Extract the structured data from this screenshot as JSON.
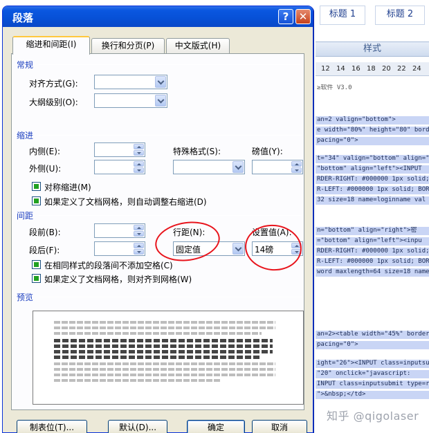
{
  "background": {
    "style_gallery": [
      "标题 1",
      "标题 2"
    ],
    "styles_caption": "样式",
    "ruler_ticks": [
      "12",
      "14",
      "16",
      "18",
      "20",
      "22",
      "24"
    ],
    "code_lines": [
      {
        "text": "≥软件 V3.0",
        "hl": false
      },
      {
        "text": "an=2 valign=\"bottom\">",
        "hl": true
      },
      {
        "text": "e width=\"80%\" height=\"80\" bord",
        "hl": true
      },
      {
        "text": "pacing=\"0\">",
        "hl": true
      },
      {
        "text": "t=\"34\" valign=\"bottom\" align=\"",
        "hl": true
      },
      {
        "text": "\"bottom\" align=\"left\"><INPUT",
        "hl": true
      },
      {
        "text": "RDER-RIGHT: #000000 1px solid;",
        "hl": true
      },
      {
        "text": "R-LEFT: #000000 1px solid; BOR",
        "hl": true
      },
      {
        "text": "32 size=18 name=loginname val",
        "hl": true
      },
      {
        "text": "n=\"bottom\" align=\"right\">密",
        "hl": true
      },
      {
        "text": "=\"bottom\" align=\"left\"><inpu",
        "hl": true
      },
      {
        "text": "RDER-RIGHT: #000000 1px solid;",
        "hl": true
      },
      {
        "text": "R-LEFT: #000000 1px solid; BOR",
        "hl": true
      },
      {
        "text": "word maxlength=64 size=18 name",
        "hl": true
      },
      {
        "text": "an=2><table width=\"45%\" border",
        "hl": true
      },
      {
        "text": "pacing=\"0\">",
        "hl": true
      },
      {
        "text": "ight=\"26\"><INPUT class=inputsu",
        "hl": true
      },
      {
        "text": "\"20\" onclick=\"javascript:",
        "hl": true
      },
      {
        "text": "INPUT class=inputsubmit type=re",
        "hl": true
      },
      {
        "text": "\">&nbsp;</td>",
        "hl": true
      }
    ],
    "watermark": "知乎 @qigolaser"
  },
  "dialog": {
    "title": "段落",
    "help_glyph": "?",
    "close_glyph": "✕",
    "tabs": [
      {
        "label": "缩进和间距(I)",
        "active": true
      },
      {
        "label": "换行和分页(P)",
        "active": false
      },
      {
        "label": "中文版式(H)",
        "active": false
      }
    ],
    "general": {
      "section": "常规",
      "alignment_label": "对齐方式(G):",
      "alignment_value": "",
      "outline_label": "大纲级别(O):",
      "outline_value": ""
    },
    "indent": {
      "section": "缩进",
      "inside_label": "内侧(E):",
      "inside_value": "",
      "outside_label": "外侧(U):",
      "outside_value": "",
      "special_label": "特殊格式(S):",
      "special_value": "",
      "by_label": "磅值(Y):",
      "by_value": "",
      "mirror_label": "对称缩进(M)",
      "mirror_checked": true,
      "auto_adjust_label": "如果定义了文档网格，则自动调整右缩进(D)",
      "auto_adjust_checked": true
    },
    "spacing": {
      "section": "间距",
      "before_label": "段前(B):",
      "before_value": "",
      "after_label": "段后(F):",
      "after_value": "",
      "line_spacing_label": "行距(N):",
      "line_spacing_value": "固定值",
      "at_label": "设置值(A):",
      "at_value": "14磅",
      "no_space_label": "在相同样式的段落间不添加空格(C)",
      "no_space_checked": true,
      "snap_grid_label": "如果定义了文档网格，则对齐到网格(W)",
      "snap_grid_checked": true
    },
    "preview": {
      "section": "预览"
    },
    "buttons": {
      "tabs_label": "制表位(T)...",
      "default_label": "默认(D)...",
      "ok_label": "确定",
      "cancel_label": "取消"
    }
  }
}
